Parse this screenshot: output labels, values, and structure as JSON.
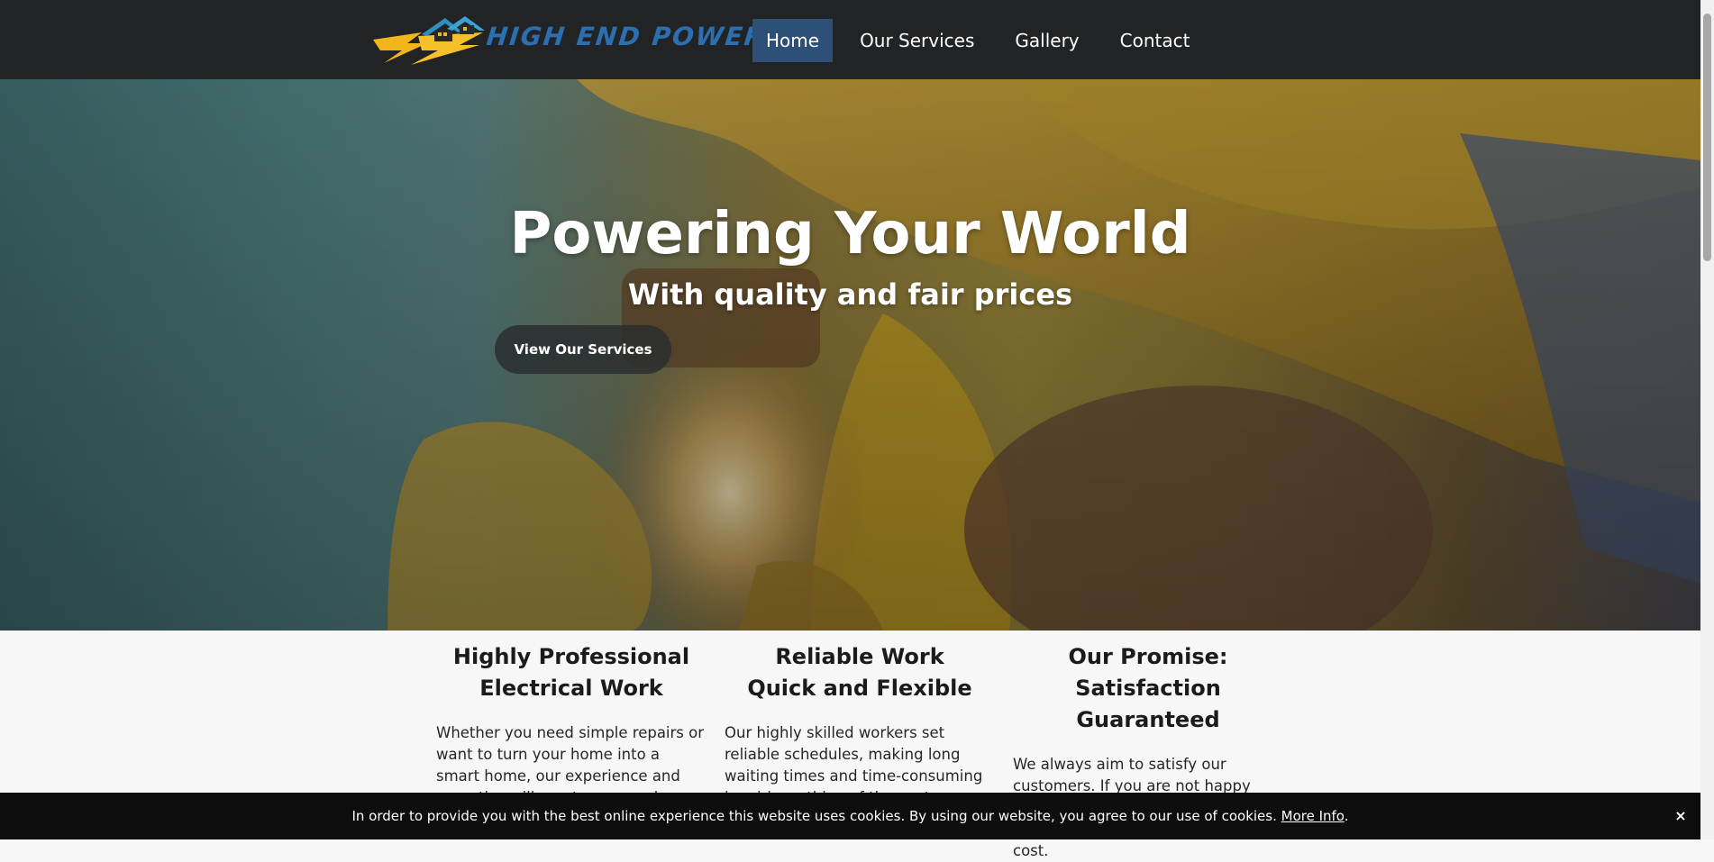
{
  "brand": {
    "name": "HIGH END POWER"
  },
  "nav": {
    "items": [
      {
        "label": "Home",
        "active": true
      },
      {
        "label": "Our Services",
        "active": false
      },
      {
        "label": "Gallery",
        "active": false
      },
      {
        "label": "Contact",
        "active": false
      }
    ]
  },
  "hero": {
    "title": "Powering Your World",
    "subtitle": "With quality and fair prices",
    "button_label": "View Our Services"
  },
  "features": [
    {
      "title_line1": "Highly Professional",
      "title_line2": "Electrical Work",
      "text": "Whether you need simple repairs or want to turn your home into a smart home, our experience and expertise will meet your needs."
    },
    {
      "title_line1": "Reliable Work",
      "title_line2": "Quick and Flexible",
      "text": "Our highly skilled workers set reliable schedules, making long waiting times and time-consuming inquiries a thing of the past."
    },
    {
      "title_line1": "Our Promise:",
      "title_line2": "Satisfaction Guaranteed",
      "text": "We always aim to satisfy our customers. If you are not happy with our work, however, we will rectify the situation at no extra cost."
    }
  ],
  "cookie": {
    "text": "In order to provide you with the best online experience this website uses cookies. By using our website, you agree to our use of cookies.",
    "link_label": "More Info",
    "period": ".",
    "close_label": "×"
  },
  "colors": {
    "header_bg": "#222324",
    "nav_active_bg": "#2e5077",
    "logo_text": "#2b6fb0",
    "logo_bolt": "#f2b51c",
    "cookie_bg": "#0e0e0e"
  }
}
